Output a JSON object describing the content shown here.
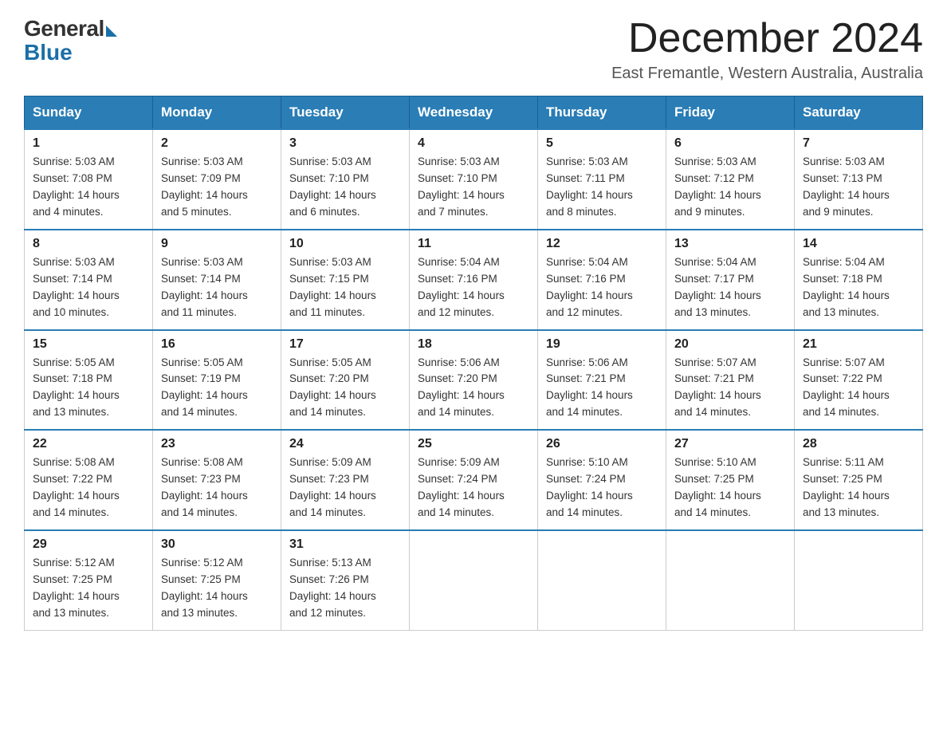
{
  "logo": {
    "general": "General",
    "blue": "Blue"
  },
  "title": "December 2024",
  "location": "East Fremantle, Western Australia, Australia",
  "days_of_week": [
    "Sunday",
    "Monday",
    "Tuesday",
    "Wednesday",
    "Thursday",
    "Friday",
    "Saturday"
  ],
  "weeks": [
    [
      {
        "day": "1",
        "sunrise": "5:03 AM",
        "sunset": "7:08 PM",
        "daylight": "14 hours and 4 minutes."
      },
      {
        "day": "2",
        "sunrise": "5:03 AM",
        "sunset": "7:09 PM",
        "daylight": "14 hours and 5 minutes."
      },
      {
        "day": "3",
        "sunrise": "5:03 AM",
        "sunset": "7:10 PM",
        "daylight": "14 hours and 6 minutes."
      },
      {
        "day": "4",
        "sunrise": "5:03 AM",
        "sunset": "7:10 PM",
        "daylight": "14 hours and 7 minutes."
      },
      {
        "day": "5",
        "sunrise": "5:03 AM",
        "sunset": "7:11 PM",
        "daylight": "14 hours and 8 minutes."
      },
      {
        "day": "6",
        "sunrise": "5:03 AM",
        "sunset": "7:12 PM",
        "daylight": "14 hours and 9 minutes."
      },
      {
        "day": "7",
        "sunrise": "5:03 AM",
        "sunset": "7:13 PM",
        "daylight": "14 hours and 9 minutes."
      }
    ],
    [
      {
        "day": "8",
        "sunrise": "5:03 AM",
        "sunset": "7:14 PM",
        "daylight": "14 hours and 10 minutes."
      },
      {
        "day": "9",
        "sunrise": "5:03 AM",
        "sunset": "7:14 PM",
        "daylight": "14 hours and 11 minutes."
      },
      {
        "day": "10",
        "sunrise": "5:03 AM",
        "sunset": "7:15 PM",
        "daylight": "14 hours and 11 minutes."
      },
      {
        "day": "11",
        "sunrise": "5:04 AM",
        "sunset": "7:16 PM",
        "daylight": "14 hours and 12 minutes."
      },
      {
        "day": "12",
        "sunrise": "5:04 AM",
        "sunset": "7:16 PM",
        "daylight": "14 hours and 12 minutes."
      },
      {
        "day": "13",
        "sunrise": "5:04 AM",
        "sunset": "7:17 PM",
        "daylight": "14 hours and 13 minutes."
      },
      {
        "day": "14",
        "sunrise": "5:04 AM",
        "sunset": "7:18 PM",
        "daylight": "14 hours and 13 minutes."
      }
    ],
    [
      {
        "day": "15",
        "sunrise": "5:05 AM",
        "sunset": "7:18 PM",
        "daylight": "14 hours and 13 minutes."
      },
      {
        "day": "16",
        "sunrise": "5:05 AM",
        "sunset": "7:19 PM",
        "daylight": "14 hours and 14 minutes."
      },
      {
        "day": "17",
        "sunrise": "5:05 AM",
        "sunset": "7:20 PM",
        "daylight": "14 hours and 14 minutes."
      },
      {
        "day": "18",
        "sunrise": "5:06 AM",
        "sunset": "7:20 PM",
        "daylight": "14 hours and 14 minutes."
      },
      {
        "day": "19",
        "sunrise": "5:06 AM",
        "sunset": "7:21 PM",
        "daylight": "14 hours and 14 minutes."
      },
      {
        "day": "20",
        "sunrise": "5:07 AM",
        "sunset": "7:21 PM",
        "daylight": "14 hours and 14 minutes."
      },
      {
        "day": "21",
        "sunrise": "5:07 AM",
        "sunset": "7:22 PM",
        "daylight": "14 hours and 14 minutes."
      }
    ],
    [
      {
        "day": "22",
        "sunrise": "5:08 AM",
        "sunset": "7:22 PM",
        "daylight": "14 hours and 14 minutes."
      },
      {
        "day": "23",
        "sunrise": "5:08 AM",
        "sunset": "7:23 PM",
        "daylight": "14 hours and 14 minutes."
      },
      {
        "day": "24",
        "sunrise": "5:09 AM",
        "sunset": "7:23 PM",
        "daylight": "14 hours and 14 minutes."
      },
      {
        "day": "25",
        "sunrise": "5:09 AM",
        "sunset": "7:24 PM",
        "daylight": "14 hours and 14 minutes."
      },
      {
        "day": "26",
        "sunrise": "5:10 AM",
        "sunset": "7:24 PM",
        "daylight": "14 hours and 14 minutes."
      },
      {
        "day": "27",
        "sunrise": "5:10 AM",
        "sunset": "7:25 PM",
        "daylight": "14 hours and 14 minutes."
      },
      {
        "day": "28",
        "sunrise": "5:11 AM",
        "sunset": "7:25 PM",
        "daylight": "14 hours and 13 minutes."
      }
    ],
    [
      {
        "day": "29",
        "sunrise": "5:12 AM",
        "sunset": "7:25 PM",
        "daylight": "14 hours and 13 minutes."
      },
      {
        "day": "30",
        "sunrise": "5:12 AM",
        "sunset": "7:25 PM",
        "daylight": "14 hours and 13 minutes."
      },
      {
        "day": "31",
        "sunrise": "5:13 AM",
        "sunset": "7:26 PM",
        "daylight": "14 hours and 12 minutes."
      },
      null,
      null,
      null,
      null
    ]
  ],
  "labels": {
    "sunrise": "Sunrise:",
    "sunset": "Sunset:",
    "daylight": "Daylight:"
  }
}
